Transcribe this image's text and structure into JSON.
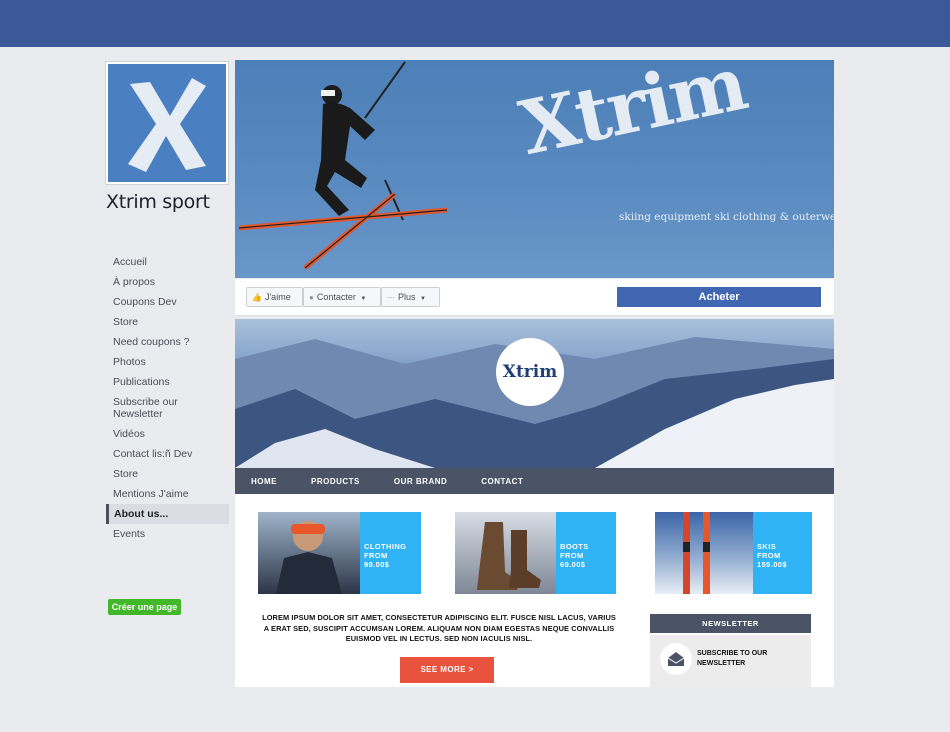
{
  "page": {
    "name": "Xtrim sport",
    "profile_logo": "X",
    "cover": {
      "brand": "Xtrim",
      "tagline": "skiing equipment   ski clothing & outerwear"
    },
    "actions": {
      "like": "J'aime",
      "contact": "Contacter",
      "more": "Plus",
      "buy": "Acheter"
    },
    "nav": [
      "Accueil",
      "À propos",
      "Coupons Dev",
      "Store",
      "Need coupons ?",
      "Photos",
      "Publications",
      "Subscribe our Newsletter",
      "Vidéos",
      "Contact lis:ñ Dev",
      "Store",
      "Mentions J'aime",
      "About us...",
      "Events"
    ],
    "active_nav": "About us...",
    "create_page": "Créer une page"
  },
  "site": {
    "logo": "Xtrim",
    "menu": [
      "HOME",
      "PRODUCTS",
      "OUR BRAND",
      "CONTACT"
    ],
    "products": [
      {
        "name": "CLOTHING",
        "from": "FROM",
        "price": "99.00$"
      },
      {
        "name": "BOOTS",
        "from": "FROM",
        "price": "69.00$"
      },
      {
        "name": "SKIS",
        "from": "FROM",
        "price": "159.00$"
      }
    ],
    "lorem": "LOREM IPSUM DOLOR SIT AMET, CONSECTETUR ADIPISCING ELIT. FUSCE NISL LACUS, VARIUS A ERAT SED, SUSCIPIT ACCUMSAN LOREM. ALIQUAM NON DIAM EGESTAS NEQUE CONVALLIS EUISMOD VEL IN LECTUS. SED NON IACULIS NISL.",
    "see_more": "SEE MORE >",
    "newsletter": {
      "header": "NEWSLETTER",
      "text": "SUBSCRIBE TO OUR NEWSLETTER"
    }
  },
  "colors": {
    "facebook_blue": "#3b5998",
    "buy_button": "#4267b2",
    "product_label": "#2fb3f5",
    "see_more": "#e9533e",
    "create_page": "#42b72a"
  },
  "icons": [
    "thumbs-up-icon",
    "chat-icon",
    "ellipsis-icon",
    "chevron-down-icon",
    "envelope-icon"
  ]
}
